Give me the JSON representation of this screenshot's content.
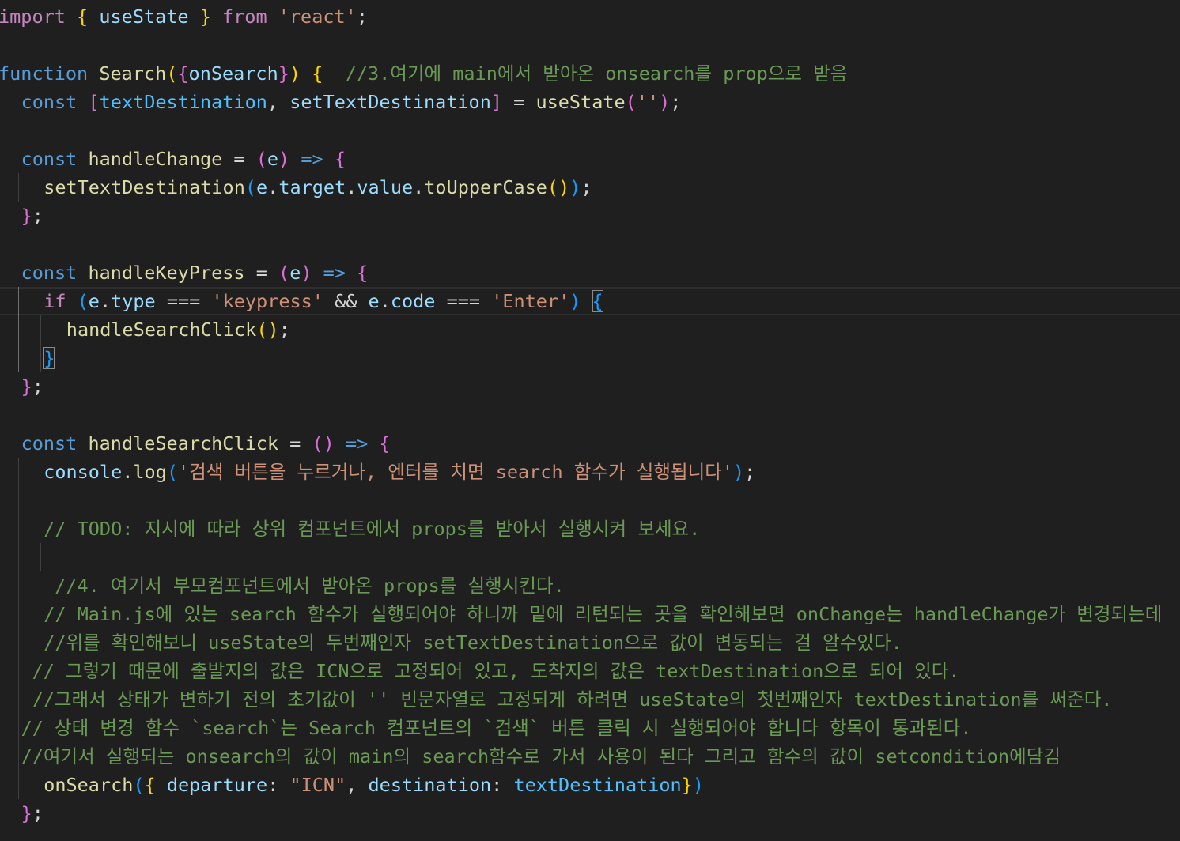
{
  "colors": {
    "keyword": "#c586c0",
    "storage": "#569cd6",
    "function": "#dcdcaa",
    "variable": "#9cdcfe",
    "constant": "#4fc1ff",
    "string": "#ce9178",
    "comment": "#6a9955",
    "bracket1": "#ffd700",
    "bracket2": "#da70d6",
    "bracket3": "#179fff",
    "plain": "#d4d4d4"
  },
  "lines": [
    {
      "indent": 0,
      "tokens": [
        {
          "t": "import",
          "c": "keyword"
        },
        {
          "t": " ",
          "c": "plain"
        },
        {
          "t": "{",
          "c": "bracket1"
        },
        {
          "t": " useState ",
          "c": "variable"
        },
        {
          "t": "}",
          "c": "bracket1"
        },
        {
          "t": " ",
          "c": "plain"
        },
        {
          "t": "from",
          "c": "keyword"
        },
        {
          "t": " ",
          "c": "plain"
        },
        {
          "t": "'react'",
          "c": "string"
        },
        {
          "t": ";",
          "c": "plain"
        }
      ]
    },
    {
      "indent": 0,
      "tokens": []
    },
    {
      "indent": 0,
      "tokens": [
        {
          "t": "function",
          "c": "storage"
        },
        {
          "t": " ",
          "c": "plain"
        },
        {
          "t": "Search",
          "c": "function"
        },
        {
          "t": "(",
          "c": "bracket1"
        },
        {
          "t": "{",
          "c": "bracket2"
        },
        {
          "t": "onSearch",
          "c": "variable"
        },
        {
          "t": "}",
          "c": "bracket2"
        },
        {
          "t": ")",
          "c": "bracket1"
        },
        {
          "t": " ",
          "c": "plain"
        },
        {
          "t": "{",
          "c": "bracket1"
        },
        {
          "t": "  ",
          "c": "plain"
        },
        {
          "t": "//3.여기에 main에서 받아온 onsearch를 prop으로 받음",
          "c": "comment"
        }
      ]
    },
    {
      "indent": 1,
      "tokens": [
        {
          "t": "const",
          "c": "storage"
        },
        {
          "t": " ",
          "c": "plain"
        },
        {
          "t": "[",
          "c": "bracket2"
        },
        {
          "t": "textDestination",
          "c": "constant"
        },
        {
          "t": ", ",
          "c": "plain"
        },
        {
          "t": "setTextDestination",
          "c": "variable"
        },
        {
          "t": "]",
          "c": "bracket2"
        },
        {
          "t": " = ",
          "c": "plain"
        },
        {
          "t": "useState",
          "c": "function"
        },
        {
          "t": "(",
          "c": "bracket2"
        },
        {
          "t": "''",
          "c": "string"
        },
        {
          "t": ")",
          "c": "bracket2"
        },
        {
          "t": ";",
          "c": "plain"
        }
      ]
    },
    {
      "indent": 0,
      "tokens": []
    },
    {
      "indent": 1,
      "tokens": [
        {
          "t": "const",
          "c": "storage"
        },
        {
          "t": " ",
          "c": "plain"
        },
        {
          "t": "handleChange",
          "c": "function"
        },
        {
          "t": " = ",
          "c": "plain"
        },
        {
          "t": "(",
          "c": "bracket2"
        },
        {
          "t": "e",
          "c": "variable"
        },
        {
          "t": ")",
          "c": "bracket2"
        },
        {
          "t": " ",
          "c": "plain"
        },
        {
          "t": "=>",
          "c": "storage"
        },
        {
          "t": " ",
          "c": "plain"
        },
        {
          "t": "{",
          "c": "bracket2"
        }
      ]
    },
    {
      "indent": 2,
      "tokens": [
        {
          "t": "setTextDestination",
          "c": "function"
        },
        {
          "t": "(",
          "c": "bracket3"
        },
        {
          "t": "e",
          "c": "variable"
        },
        {
          "t": ".",
          "c": "plain"
        },
        {
          "t": "target",
          "c": "variable"
        },
        {
          "t": ".",
          "c": "plain"
        },
        {
          "t": "value",
          "c": "variable"
        },
        {
          "t": ".",
          "c": "plain"
        },
        {
          "t": "toUpperCase",
          "c": "function"
        },
        {
          "t": "()",
          "c": "bracket1"
        },
        {
          "t": ")",
          "c": "bracket3"
        },
        {
          "t": ";",
          "c": "plain"
        }
      ]
    },
    {
      "indent": 1,
      "tokens": [
        {
          "t": "}",
          "c": "bracket2"
        },
        {
          "t": ";",
          "c": "plain"
        }
      ]
    },
    {
      "indent": 0,
      "tokens": []
    },
    {
      "indent": 1,
      "tokens": [
        {
          "t": "const",
          "c": "storage"
        },
        {
          "t": " ",
          "c": "plain"
        },
        {
          "t": "handleKeyPress",
          "c": "function"
        },
        {
          "t": " = ",
          "c": "plain"
        },
        {
          "t": "(",
          "c": "bracket2"
        },
        {
          "t": "e",
          "c": "variable"
        },
        {
          "t": ")",
          "c": "bracket2"
        },
        {
          "t": " ",
          "c": "plain"
        },
        {
          "t": "=>",
          "c": "storage"
        },
        {
          "t": " ",
          "c": "plain"
        },
        {
          "t": "{",
          "c": "bracket2"
        }
      ]
    },
    {
      "indent": 2,
      "tokens": [
        {
          "t": "if",
          "c": "keyword"
        },
        {
          "t": " ",
          "c": "plain"
        },
        {
          "t": "(",
          "c": "bracket3"
        },
        {
          "t": "e",
          "c": "variable"
        },
        {
          "t": ".",
          "c": "plain"
        },
        {
          "t": "type",
          "c": "variable"
        },
        {
          "t": " === ",
          "c": "plain"
        },
        {
          "t": "'keypress'",
          "c": "string"
        },
        {
          "t": " && ",
          "c": "plain"
        },
        {
          "t": "e",
          "c": "variable"
        },
        {
          "t": ".",
          "c": "plain"
        },
        {
          "t": "code",
          "c": "variable"
        },
        {
          "t": " === ",
          "c": "plain"
        },
        {
          "t": "'Enter'",
          "c": "string"
        },
        {
          "t": ")",
          "c": "bracket3"
        },
        {
          "t": " ",
          "c": "plain"
        },
        {
          "t": "{",
          "c": "bracket3",
          "match": true
        }
      ]
    },
    {
      "indent": 3,
      "tokens": [
        {
          "t": "handleSearchClick",
          "c": "function"
        },
        {
          "t": "()",
          "c": "bracket1"
        },
        {
          "t": ";",
          "c": "plain"
        }
      ]
    },
    {
      "indent": 2,
      "tokens": [
        {
          "t": "}",
          "c": "bracket3",
          "match": true
        }
      ]
    },
    {
      "indent": 1,
      "tokens": [
        {
          "t": "}",
          "c": "bracket2"
        },
        {
          "t": ";",
          "c": "plain"
        }
      ]
    },
    {
      "indent": 0,
      "tokens": []
    },
    {
      "indent": 1,
      "tokens": [
        {
          "t": "const",
          "c": "storage"
        },
        {
          "t": " ",
          "c": "plain"
        },
        {
          "t": "handleSearchClick",
          "c": "function"
        },
        {
          "t": " = ",
          "c": "plain"
        },
        {
          "t": "()",
          "c": "bracket2"
        },
        {
          "t": " ",
          "c": "plain"
        },
        {
          "t": "=>",
          "c": "storage"
        },
        {
          "t": " ",
          "c": "plain"
        },
        {
          "t": "{",
          "c": "bracket2"
        }
      ]
    },
    {
      "indent": 2,
      "tokens": [
        {
          "t": "console",
          "c": "variable"
        },
        {
          "t": ".",
          "c": "plain"
        },
        {
          "t": "log",
          "c": "function"
        },
        {
          "t": "(",
          "c": "bracket3"
        },
        {
          "t": "'검색 버튼을 누르거나, 엔터를 치면 search 함수가 실행됩니다'",
          "c": "string"
        },
        {
          "t": ")",
          "c": "bracket3"
        },
        {
          "t": ";",
          "c": "plain"
        }
      ]
    },
    {
      "indent": 0,
      "tokens": []
    },
    {
      "indent": 2,
      "tokens": [
        {
          "t": "// TODO: 지시에 따라 상위 컴포넌트에서 props를 받아서 실행시켜 보세요.",
          "c": "comment"
        }
      ]
    },
    {
      "indent": 0,
      "tokens": []
    },
    {
      "indent": 2,
      "offset": 14,
      "tokens": [
        {
          "t": "//4. 여기서 부모컴포넌트에서 받아온 props를 실행시킨다.",
          "c": "comment"
        }
      ]
    },
    {
      "indent": 2,
      "tokens": [
        {
          "t": "// Main.js에 있는 search 함수가 실행되어야 하니까 밑에 리턴되는 곳을 확인해보면 onChange는 handleChange가 변경되는데",
          "c": "comment"
        }
      ]
    },
    {
      "indent": 2,
      "tokens": [
        {
          "t": "//위를 확인해보니 useState의 두번째인자 setTextDestination으로 값이 변동되는 걸 알수있다.",
          "c": "comment"
        }
      ]
    },
    {
      "indent": 1,
      "offset": 14,
      "tokens": [
        {
          "t": "// 그렇기 때문에 출발지의 값은 ICN으로 고정되어 있고, 도착지의 값은 textDestination으로 되어 있다.",
          "c": "comment"
        }
      ]
    },
    {
      "indent": 1,
      "offset": 14,
      "tokens": [
        {
          "t": "//그래서 상태가 변하기 전의 초기값이 '' 빈문자열로 고정되게 하려면 useState의 첫번째인자 textDestination를 써준다.",
          "c": "comment"
        }
      ]
    },
    {
      "indent": 1,
      "tokens": [
        {
          "t": "// 상태 변경 함수 `search`는 Search 컴포넌트의 `검색` 버튼 클릭 시 실행되어야 합니다 항목이 통과된다.",
          "c": "comment"
        }
      ]
    },
    {
      "indent": 1,
      "tokens": [
        {
          "t": "//여기서 실행되는 onsearch의 값이 main의 search함수로 가서 사용이 된다 그리고 함수의 값이 setcondition에담김",
          "c": "comment"
        }
      ]
    },
    {
      "indent": 2,
      "tokens": [
        {
          "t": "onSearch",
          "c": "function"
        },
        {
          "t": "(",
          "c": "bracket3"
        },
        {
          "t": "{",
          "c": "bracket1"
        },
        {
          "t": " ",
          "c": "plain"
        },
        {
          "t": "departure",
          "c": "variable"
        },
        {
          "t": ": ",
          "c": "plain"
        },
        {
          "t": "\"ICN\"",
          "c": "string"
        },
        {
          "t": ", ",
          "c": "plain"
        },
        {
          "t": "destination",
          "c": "variable"
        },
        {
          "t": ": ",
          "c": "plain"
        },
        {
          "t": "textDestination",
          "c": "constant"
        },
        {
          "t": "}",
          "c": "bracket1"
        },
        {
          "t": ")",
          "c": "bracket3"
        }
      ]
    },
    {
      "indent": 1,
      "tokens": [
        {
          "t": "}",
          "c": "bracket2"
        },
        {
          "t": ";",
          "c": "plain"
        }
      ]
    }
  ]
}
